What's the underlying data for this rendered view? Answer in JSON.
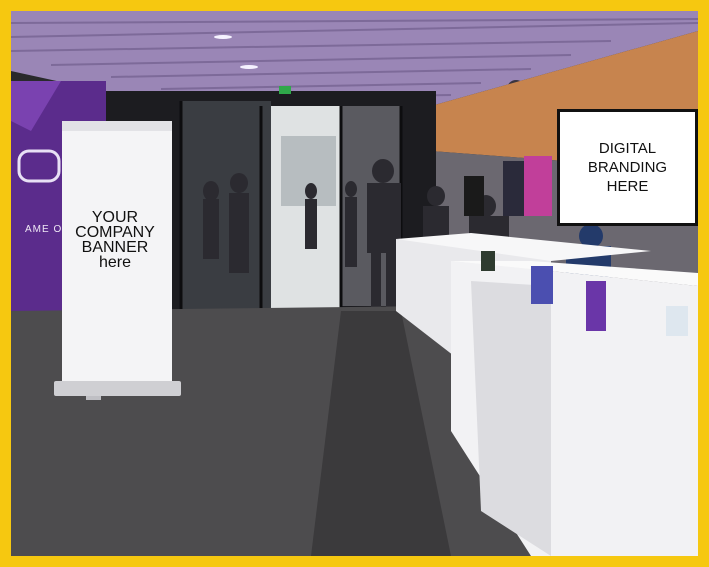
{
  "banner": {
    "lines": [
      "YOUR",
      "COMPANY",
      "BANNER",
      "here"
    ]
  },
  "digital_sign": {
    "lines": [
      "DIGITAL",
      "BRANDING",
      "HERE"
    ]
  },
  "venue_sign": {
    "text": "AME O"
  },
  "colors": {
    "frame": "#f6c810",
    "ceiling": "#9c84b8",
    "carpet": "#4a4a4c",
    "counter": "#f2f2f2",
    "accent_purple": "#6a2fa0"
  }
}
